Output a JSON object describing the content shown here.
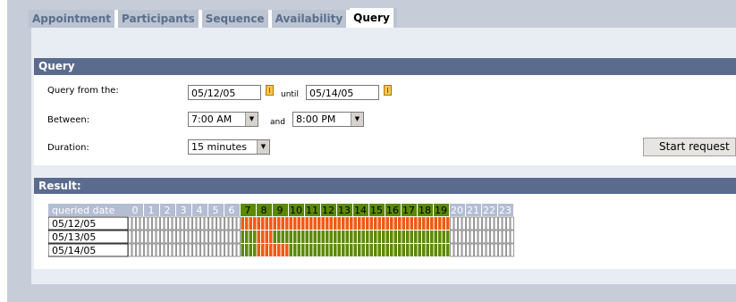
{
  "tabs": [
    "Appointment",
    "Participants",
    "Sequence",
    "Availability",
    "Query"
  ],
  "query_header": "Query",
  "form": {
    "from_label": "Query from the:",
    "from_date": "05/12/05",
    "until_label": "until",
    "until_date": "05/14/05",
    "between_label": "Between:",
    "start_time": "7:00 AM",
    "and_label": "and",
    "end_time": "8:00 PM",
    "duration_label": "Duration:",
    "duration": "15 minutes",
    "start_button": "Start request"
  },
  "result_header": "Result:",
  "grid": {
    "date_header": "queried date",
    "hours": [
      "0",
      "1",
      "2",
      "3",
      "4",
      "5",
      "6",
      "7",
      "8",
      "9",
      "10",
      "11",
      "12",
      "13",
      "14",
      "15",
      "16",
      "17",
      "18",
      "19",
      "20",
      "21",
      "22",
      "23"
    ],
    "rows": [
      {
        "date": "05/12/05",
        "busy_hours": [
          7,
          8,
          9,
          10,
          11,
          12,
          13,
          14,
          15,
          16,
          17,
          18,
          19
        ]
      },
      {
        "date": "05/13/05",
        "busy_hours": [
          8
        ]
      },
      {
        "date": "05/14/05",
        "busy_hours": [
          8,
          9
        ]
      }
    ],
    "colors": {
      "header": "#5b8a00",
      "header_off": "#b3bdd3",
      "free": "#5b8a00",
      "busy": "#f05a0f",
      "off": "#ffffff"
    }
  }
}
